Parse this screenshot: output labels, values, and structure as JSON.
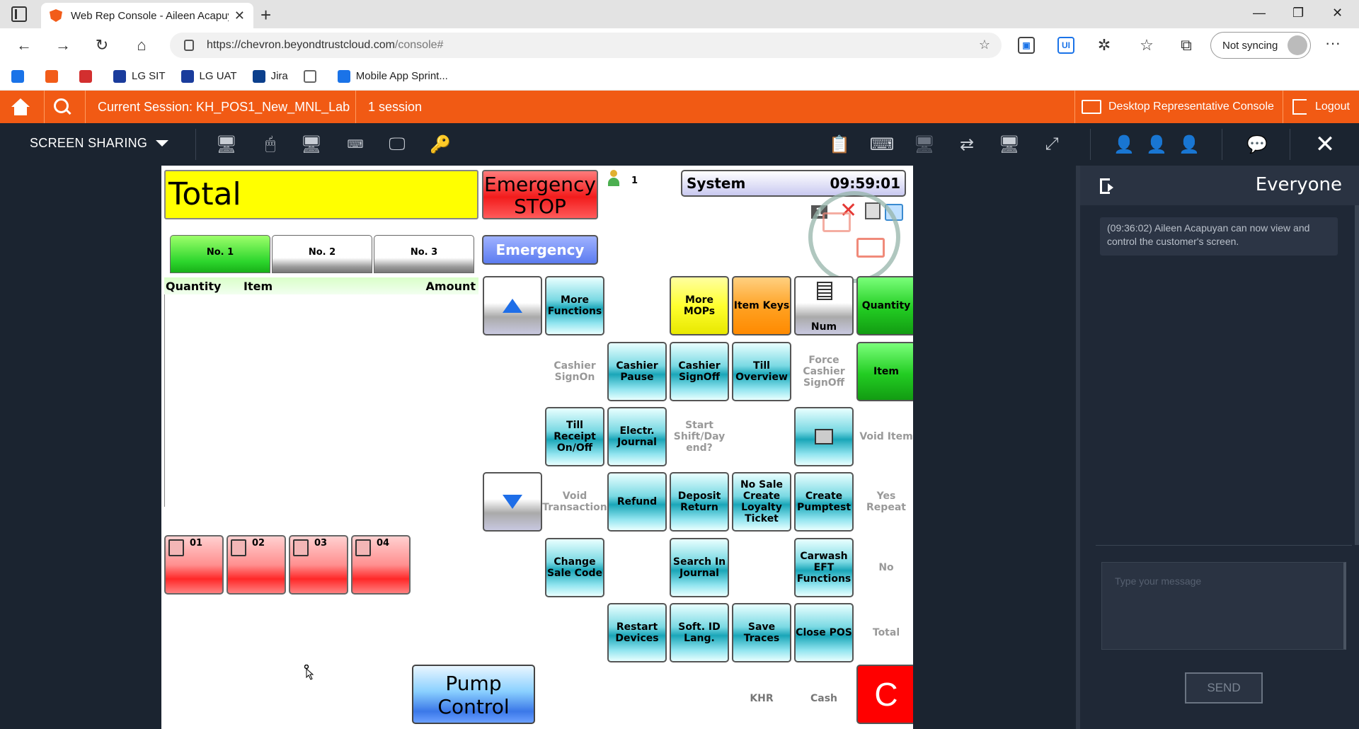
{
  "browser": {
    "tab_title": "Web Rep Console - Aileen Acapuyan",
    "url_host": "https://chevron.beyondtrustcloud.com",
    "url_path": "/console#",
    "sync_label": "Not syncing",
    "bookmarks": [
      {
        "label": "",
        "color": "#1a73e8"
      },
      {
        "label": "",
        "color": "#f25c19"
      },
      {
        "label": "",
        "color": "#d32f2f"
      },
      {
        "label": "LG SIT",
        "color": "#1a3c9c"
      },
      {
        "label": "LG UAT",
        "color": "#1a3c9c"
      },
      {
        "label": "Jira",
        "color": "#0b3f8c"
      },
      {
        "label": "",
        "color": "#666666"
      },
      {
        "label": "Mobile App Sprint...",
        "color": "#1a73e8"
      }
    ]
  },
  "console": {
    "session_label": "Current Session: KH_POS1_New_MNL_Lab",
    "session_count": "1 session",
    "desktop_console": "Desktop Representative Console",
    "logout": "Logout",
    "screen_sharing": "SCREEN SHARING",
    "accent_color": "#f15a14"
  },
  "pos": {
    "total_label": "Total",
    "estop_line1": "Emergency",
    "estop_line2": "STOP",
    "user_count": "1",
    "system_label": "System",
    "time": "09:59:01",
    "status_count": "1",
    "tabs": [
      "No. 1",
      "No. 2",
      "No. 3"
    ],
    "emergency": "Emergency",
    "col_quantity": "Quantity",
    "col_item": "Item",
    "col_amount": "Amount",
    "pumps": [
      "01",
      "02",
      "03",
      "04"
    ],
    "pump_control_line1": "Pump",
    "pump_control_line2": "Control",
    "keys": {
      "more_functions": "More Functions",
      "more_mops": "More MOPs",
      "item_keys": "Item Keys",
      "num": "Num",
      "quantity": "Quantity",
      "cashier_signon": "Cashier SignOn",
      "cashier_pause": "Cashier Pause",
      "cashier_signoff": "Cashier SignOff",
      "till_overview": "Till Overview",
      "force_cashier_signoff": "Force Cashier SignOff",
      "item": "Item",
      "till_receipt": "Till Receipt On/Off",
      "electr_journal": "Electr. Journal",
      "start_shift": "Start Shift/Day end?",
      "void_item": "Void Item",
      "void_transaction": "Void Transaction",
      "refund": "Refund",
      "deposit_return": "Deposit Return",
      "no_sale": "No Sale Create Loyalty Ticket",
      "create_pumptest": "Create Pumptest",
      "yes_repeat": "Yes Repeat",
      "change_sale_code": "Change Sale Code",
      "search_journal": "Search In Journal",
      "carwash_eft": "Carwash EFT Functions",
      "no": "No",
      "restart_devices": "Restart Devices",
      "soft_id": "Soft. ID Lang.",
      "save_traces": "Save Traces",
      "close_pos": "Close POS",
      "total": "Total",
      "khr": "KHR",
      "cash": "Cash",
      "clear": "C"
    }
  },
  "chat": {
    "title": "Everyone",
    "message": "(09:36:02) Aileen Acapuyan can now view and control the customer's screen.",
    "placeholder": "Type your message",
    "send": "SEND"
  }
}
